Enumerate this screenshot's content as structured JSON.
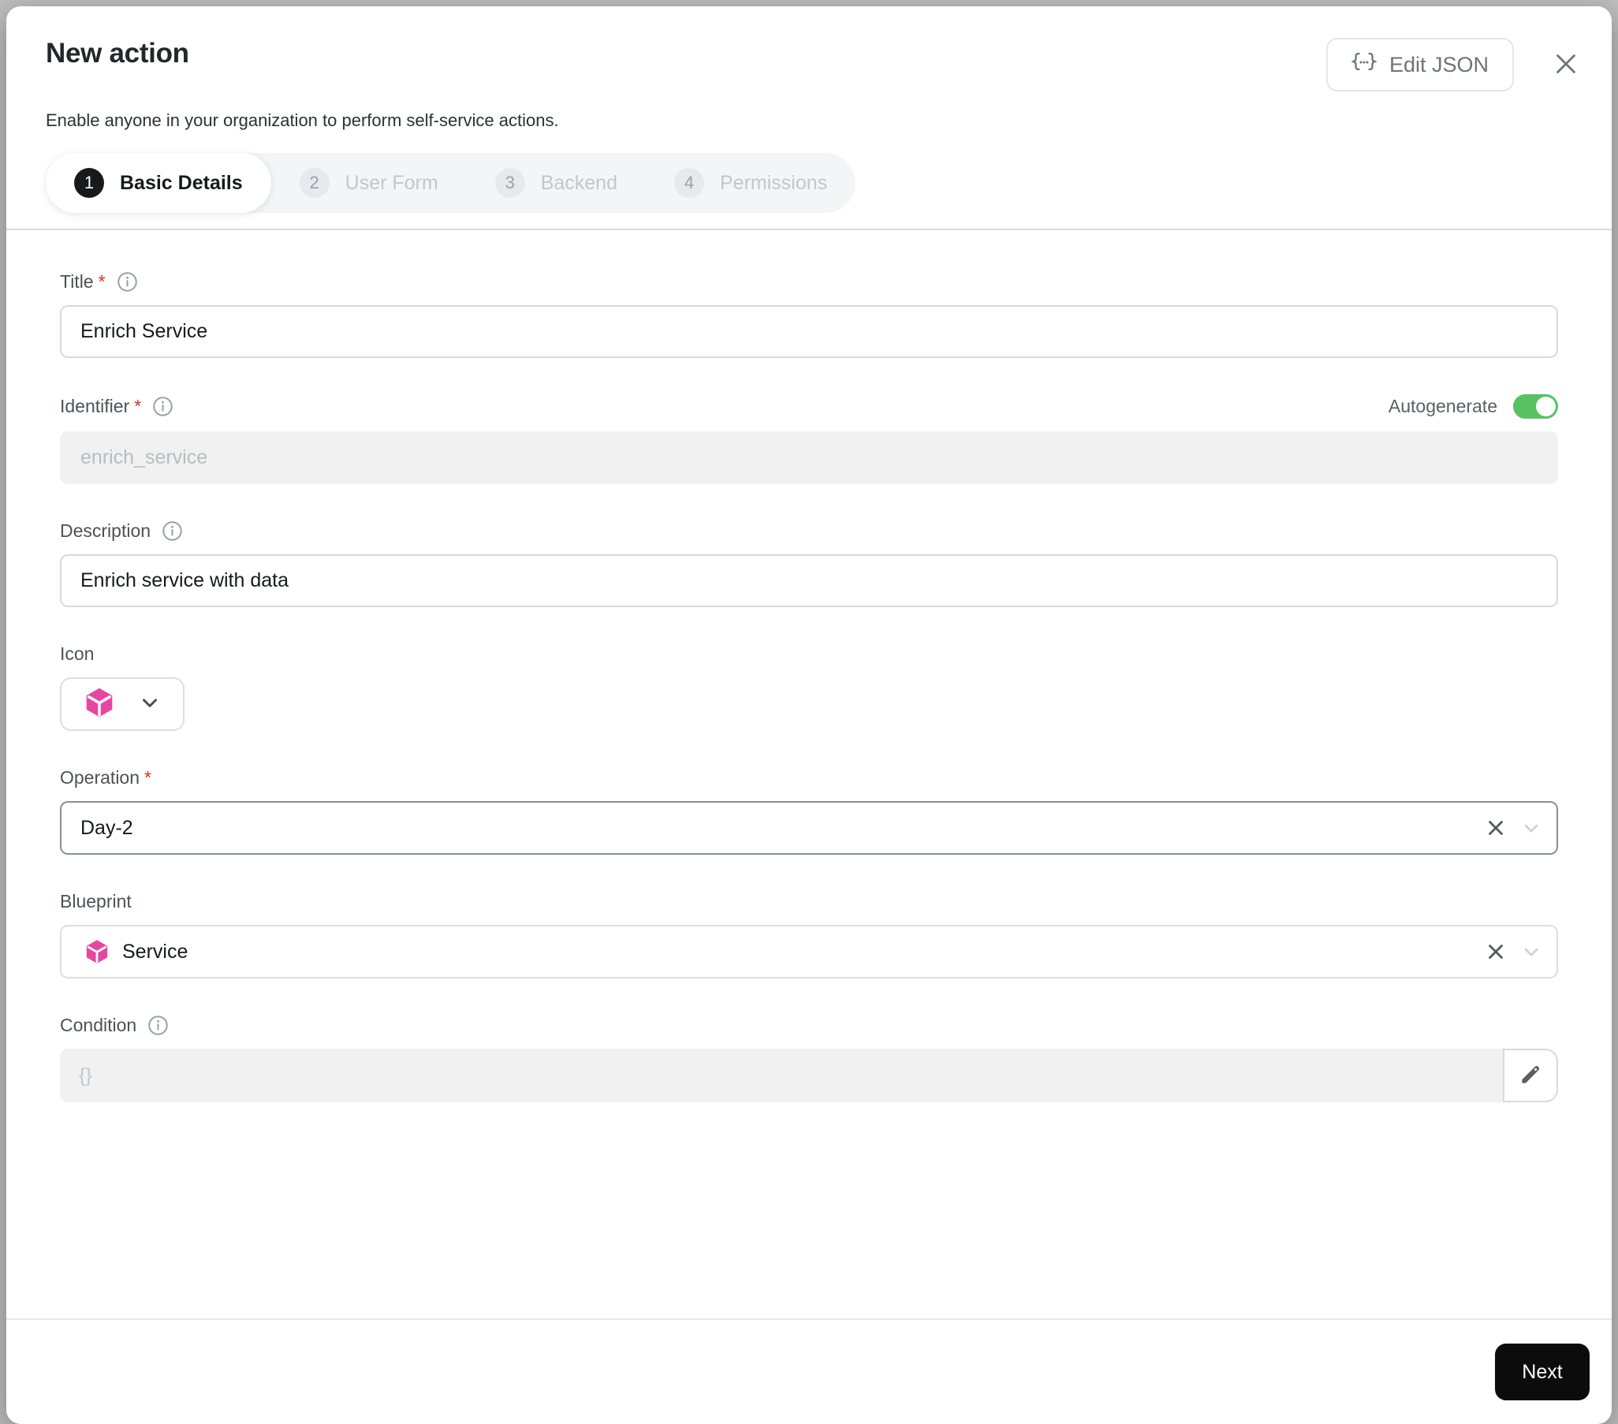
{
  "header": {
    "title": "New action",
    "subtitle": "Enable anyone in your organization to perform self-service actions.",
    "edit_json_label": "Edit JSON"
  },
  "stepper": {
    "active_step": "Basic Details",
    "steps": [
      {
        "number": "1",
        "label": "Basic Details"
      },
      {
        "number": "2",
        "label": "User Form"
      },
      {
        "number": "3",
        "label": "Backend"
      },
      {
        "number": "4",
        "label": "Permissions"
      }
    ]
  },
  "form": {
    "required_mark": "*",
    "title": {
      "label": "Title",
      "value": "Enrich Service",
      "required": true
    },
    "identifier": {
      "label": "Identifier",
      "value": "enrich_service",
      "required": true,
      "autogenerate_label": "Autogenerate",
      "autogenerate_on": true
    },
    "description": {
      "label": "Description",
      "value": "Enrich service with data"
    },
    "icon": {
      "label": "Icon",
      "selected_icon": "cube-icon"
    },
    "operation": {
      "label": "Operation",
      "value": "Day-2",
      "required": true
    },
    "blueprint": {
      "label": "Blueprint",
      "value": "Service",
      "icon": "cube-icon"
    },
    "condition": {
      "label": "Condition",
      "placeholder": "{}"
    }
  },
  "footer": {
    "next_label": "Next"
  },
  "colors": {
    "accent_pink": "#e7459f",
    "toggle_green": "#58c263",
    "next_button": "#0c0c0d",
    "required_red": "#d93025"
  }
}
